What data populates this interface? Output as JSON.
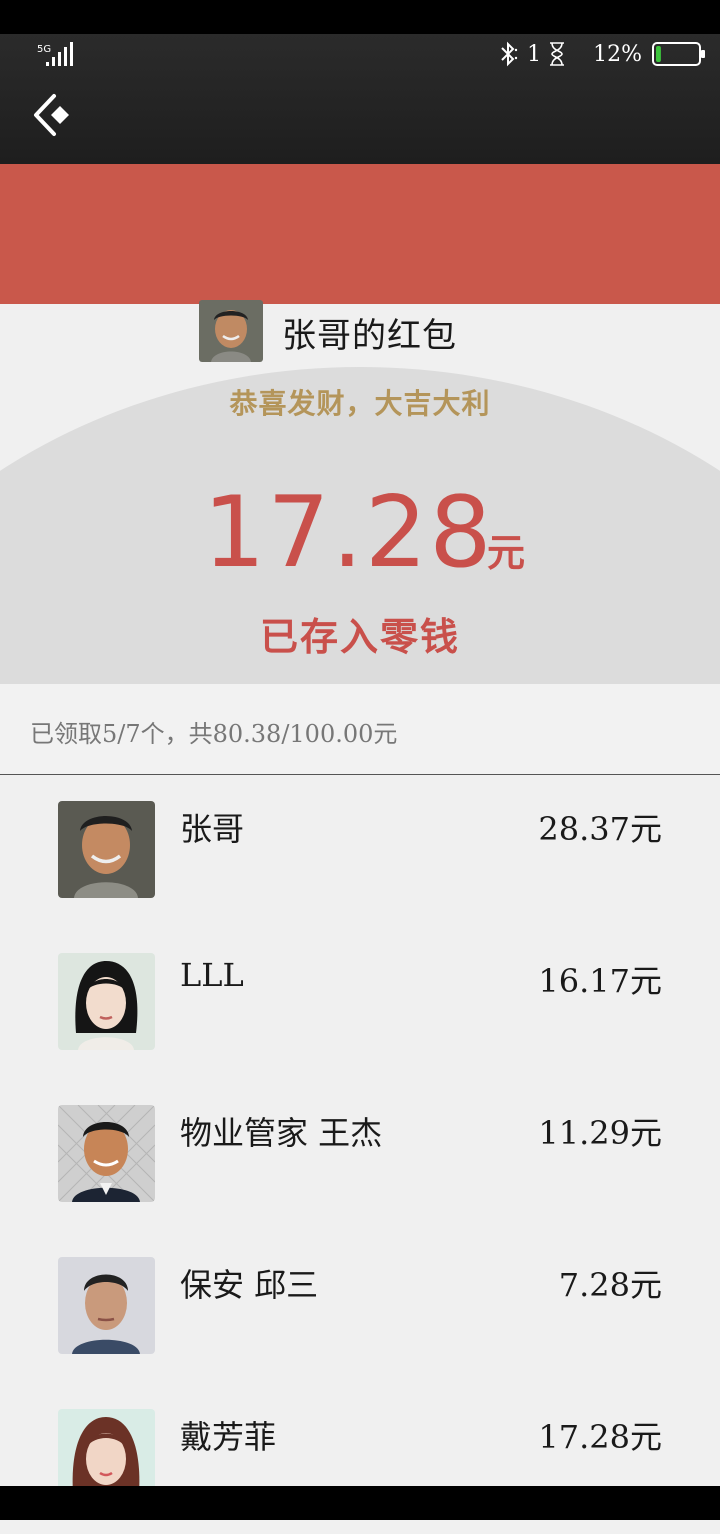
{
  "status": {
    "network": "5G",
    "bluetooth_count": "1",
    "battery_pct": "12%"
  },
  "colors": {
    "accent_red": "#c9504b",
    "gold": "#b4955a",
    "battery_level": "#3cc33c"
  },
  "header": {
    "back_icon": "back-chevron-icon"
  },
  "envelope": {
    "title": "张哥的红包",
    "greeting": "恭喜发财，大吉大利",
    "amount": "17.28",
    "unit": "元",
    "saved_label": "已存入零钱"
  },
  "summary": {
    "text": "已领取5/7个，共80.38/100.00元"
  },
  "recipients": [
    {
      "name": "张哥",
      "amount": "28.37元"
    },
    {
      "name": "LLL",
      "amount": "16.17元"
    },
    {
      "name": "物业管家 王杰",
      "amount": "11.29元"
    },
    {
      "name": "保安 邱三",
      "amount": "7.28元"
    },
    {
      "name": "戴芳菲",
      "amount": "17.28元"
    }
  ]
}
